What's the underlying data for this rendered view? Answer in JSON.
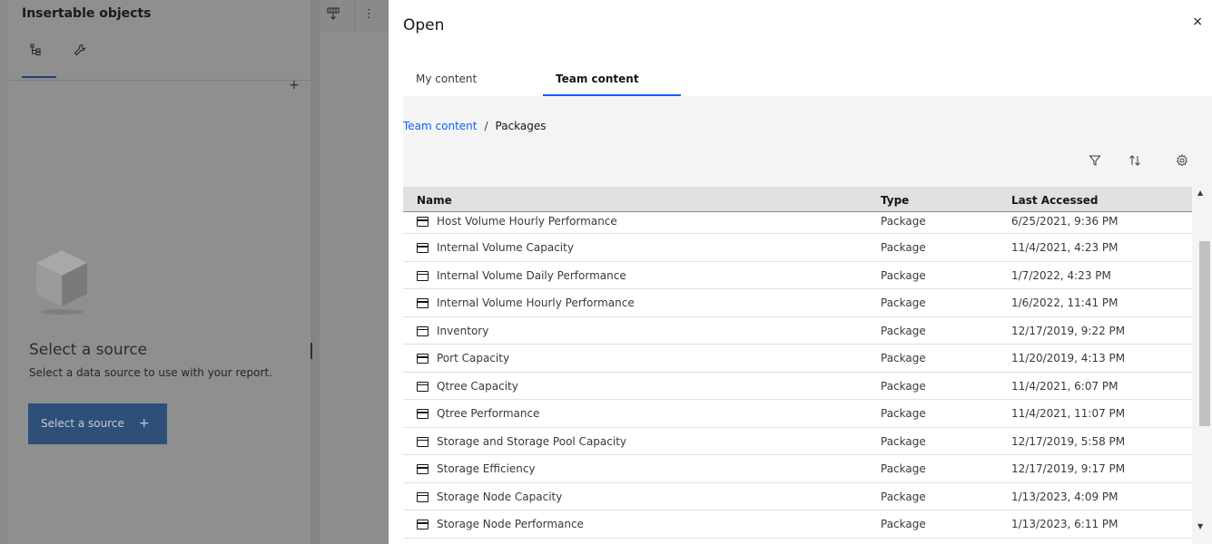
{
  "left_panel": {
    "title": "Insertable objects",
    "tab1_icon": "source-tree-icon",
    "tab2_icon": "wrench-icon",
    "plus": "+",
    "empty_title": "Select a source",
    "empty_subtitle": "Select a data source to use with your report.",
    "button_label": "Select a source",
    "button_plus": "+"
  },
  "toolbar": {
    "icon1": "insert-table-icon",
    "icon2": "overflow-menu-icon"
  },
  "dialog": {
    "title": "Open",
    "close": "×",
    "tabs": [
      {
        "label": "My content",
        "active": false
      },
      {
        "label": "Team content",
        "active": true
      }
    ],
    "breadcrumb": {
      "root": "Team content",
      "separator": "/",
      "current": "Packages"
    },
    "tools": [
      "filter-icon",
      "sort-icon",
      "settings-icon"
    ],
    "table": {
      "headers": {
        "name": "Name",
        "type": "Type",
        "last_accessed": "Last Accessed"
      },
      "rows": [
        {
          "name": "Host Volume Hourly Performance",
          "type": "Package",
          "last_accessed": "6/25/2021, 9:36 PM"
        },
        {
          "name": "Internal Volume Capacity",
          "type": "Package",
          "last_accessed": "11/4/2021, 4:23 PM"
        },
        {
          "name": "Internal Volume Daily Performance",
          "type": "Package",
          "last_accessed": "1/7/2022, 4:23 PM"
        },
        {
          "name": "Internal Volume Hourly Performance",
          "type": "Package",
          "last_accessed": "1/6/2022, 11:41 PM"
        },
        {
          "name": "Inventory",
          "type": "Package",
          "last_accessed": "12/17/2019, 9:22 PM"
        },
        {
          "name": "Port Capacity",
          "type": "Package",
          "last_accessed": "11/20/2019, 4:13 PM"
        },
        {
          "name": "Qtree Capacity",
          "type": "Package",
          "last_accessed": "11/4/2021, 6:07 PM"
        },
        {
          "name": "Qtree Performance",
          "type": "Package",
          "last_accessed": "11/4/2021, 11:07 PM"
        },
        {
          "name": "Storage and Storage Pool Capacity",
          "type": "Package",
          "last_accessed": "12/17/2019, 5:58 PM"
        },
        {
          "name": "Storage Efficiency",
          "type": "Package",
          "last_accessed": "12/17/2019, 9:17 PM"
        },
        {
          "name": "Storage Node Capacity",
          "type": "Package",
          "last_accessed": "1/13/2023, 4:09 PM"
        },
        {
          "name": "Storage Node Performance",
          "type": "Package",
          "last_accessed": "1/13/2023, 6:11 PM"
        }
      ]
    }
  },
  "colors": {
    "accent": "#0f62fe",
    "overlay": "#8d8d8d",
    "button": "#2e4f78"
  }
}
